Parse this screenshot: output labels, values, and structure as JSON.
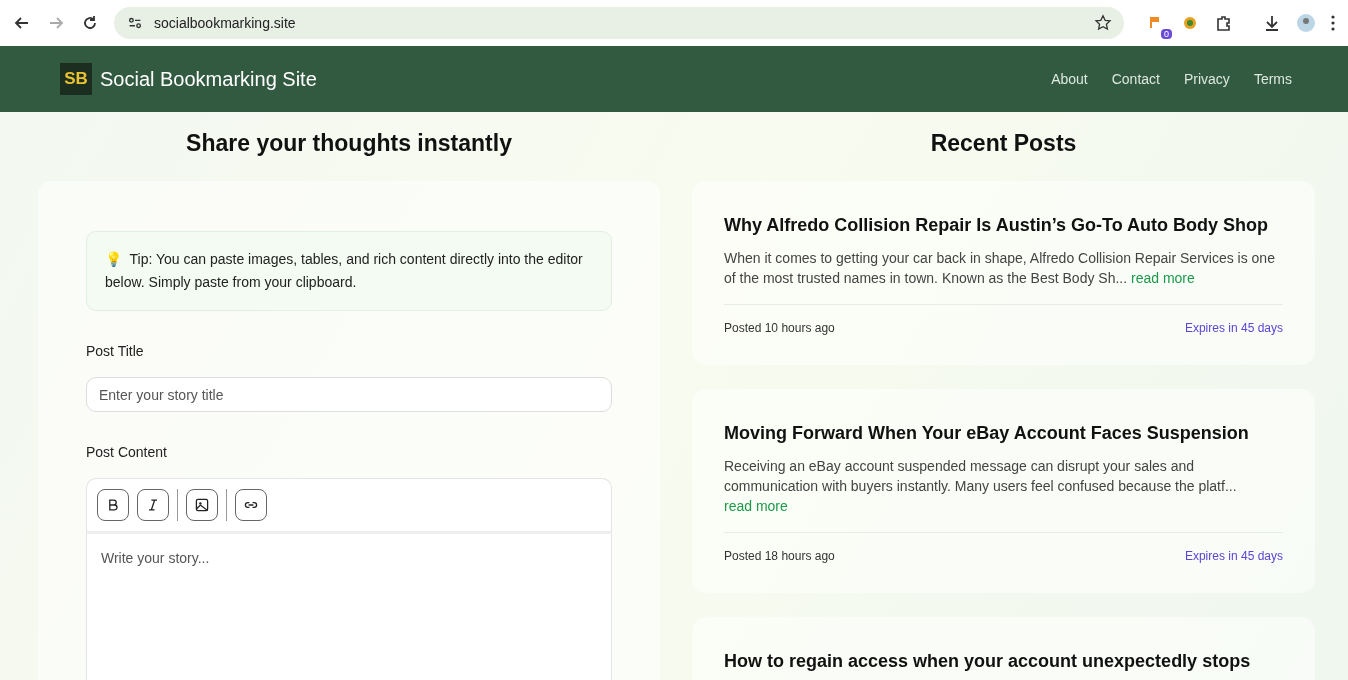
{
  "browser": {
    "url": "socialbookmarking.site",
    "extension_badge": "0"
  },
  "header": {
    "logo": "SB",
    "site_name": "Social Bookmarking Site",
    "nav": [
      "About",
      "Contact",
      "Privacy",
      "Terms"
    ]
  },
  "composer": {
    "heading": "Share your thoughts instantly",
    "tip_icon": "💡",
    "tip": "Tip: You can paste images, tables, and rich content directly into the editor below. Simply paste from your clipboard.",
    "title_label": "Post Title",
    "title_placeholder": "Enter your story title",
    "content_label": "Post Content",
    "toolbar": [
      {
        "kind": "bold"
      },
      {
        "kind": "italic"
      },
      {
        "kind": "image"
      },
      {
        "kind": "link"
      }
    ],
    "content_placeholder": "Write your story..."
  },
  "recent": {
    "heading": "Recent Posts",
    "posts": [
      {
        "title": "Why Alfredo Collision Repair Is Austin’s Go-To Auto Body Shop",
        "excerpt": "When it comes to getting your car back in shape, Alfredo Collision Repair Services is one of the most trusted names in town. Known as the Best Body Sh...",
        "link": "read more",
        "posted": "Posted 10 hours ago",
        "expires": "Expires in 45 days"
      },
      {
        "title": "Moving Forward When Your eBay Account Faces Suspension",
        "excerpt": "Receiving an eBay account suspended message can disrupt your sales and communication with buyers instantly. Many users feel confused because the platf...",
        "link": "read more",
        "posted": "Posted 18 hours ago",
        "expires": "Expires in 45 days"
      },
      {
        "title": "How to regain access when your account unexpectedly stops"
      }
    ]
  }
}
